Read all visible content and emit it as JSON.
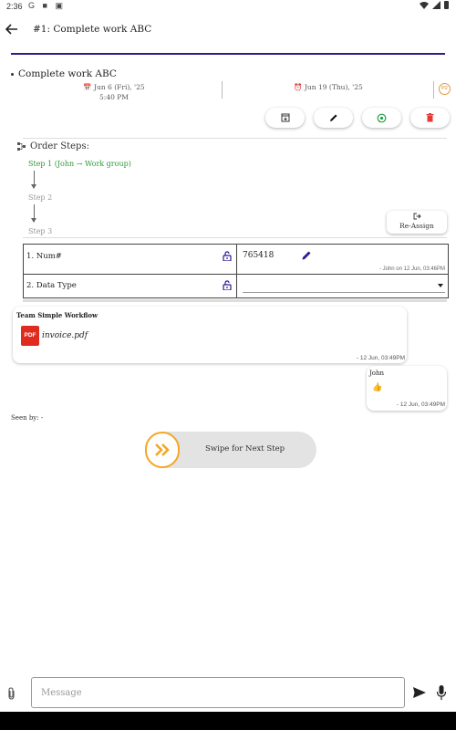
{
  "status_bar": {
    "time": "2:36",
    "icons_text": "G ■ ▣"
  },
  "app_bar": {
    "title": "#1: Complete work ABC"
  },
  "task": {
    "title": "Complete work ABC",
    "start_date": "Jun 6 (Fri), '25",
    "start_time": "5:40 PM",
    "due_date": "Jun 19 (Thu), '25",
    "priority": "P2"
  },
  "actions": {
    "colors": {
      "archive": "#333333",
      "edit": "#111111",
      "whatsapp": "#25a244",
      "delete": "#e53935"
    }
  },
  "order_steps": {
    "label": "Order Steps:",
    "steps": [
      {
        "label": "Step 1 (John → Work group)",
        "active": true
      },
      {
        "label": "Step 2",
        "active": false
      },
      {
        "label": "Step 3",
        "active": false
      }
    ],
    "reassign_label": "Re-Assign"
  },
  "fields": [
    {
      "label": "1. Num#",
      "value": "765418",
      "meta": "- John on 12 Jun, 03:46PM"
    },
    {
      "label": "2. Data Type",
      "value": "",
      "meta": ""
    }
  ],
  "messages": [
    {
      "sender": "Team Simple Workflow",
      "attachment_icon": "PDF",
      "attachment": "invoice.pdf",
      "time": "- 12 Jun, 03:49PM"
    },
    {
      "sender": "John",
      "text": "👍",
      "time": "- 12 Jun, 03:49PM"
    }
  ],
  "seen_by": "Seen by: -",
  "swipe": {
    "label": "Swipe for Next Step",
    "accent": "#f5a623"
  },
  "composer": {
    "placeholder": "Message"
  },
  "theme": {
    "accent_line": "#2d1b8f",
    "step_active": "#2e9a3a",
    "icon_blue": "#2d1b8f"
  }
}
